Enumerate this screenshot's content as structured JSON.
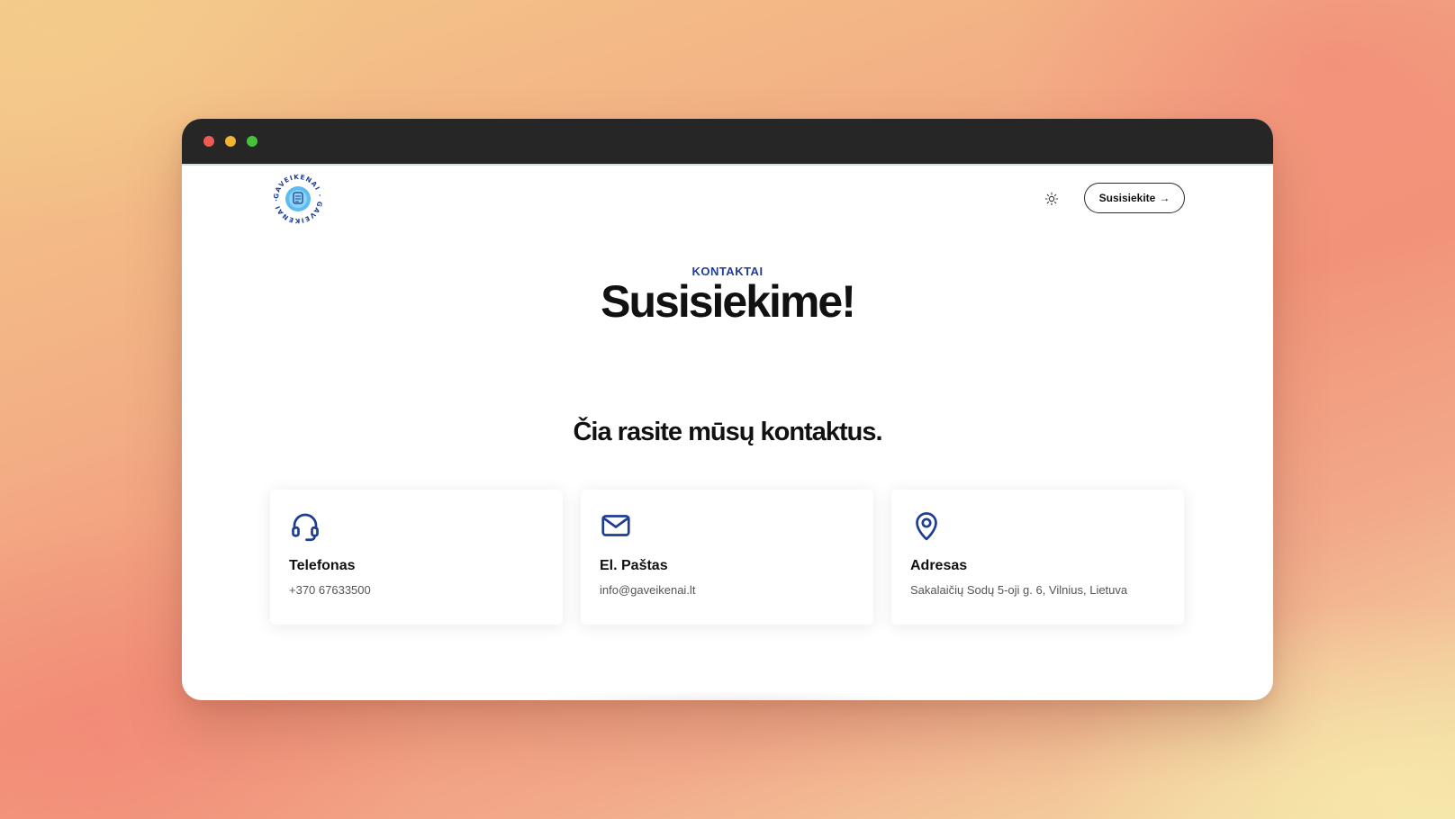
{
  "window": {
    "controls": [
      "close",
      "minimize",
      "maximize"
    ]
  },
  "nav": {
    "logo_text": "GAVEIKENAI · GAVEIKENAI ·",
    "theme_icon": "sun-icon",
    "cta_label": "Susisiekite",
    "cta_arrow": "→"
  },
  "hero": {
    "eyebrow": "KONTAKTAI",
    "title": "Susisiekime!"
  },
  "section": {
    "subtitle": "Čia rasite mūsų kontaktus."
  },
  "cards": [
    {
      "icon": "headset-icon",
      "title": "Telefonas",
      "text": "+370 67633500"
    },
    {
      "icon": "mail-icon",
      "title": "El. Paštas",
      "text": "info@gaveikenai.lt"
    },
    {
      "icon": "map-pin-icon",
      "title": "Adresas",
      "text": "Sakalaičių Sodų 5-oji g. 6, Vilnius, Lietuva"
    }
  ],
  "colors": {
    "accent": "#1e3d94",
    "logo_fill": "#5bbcef",
    "titlebar": "#262626"
  }
}
